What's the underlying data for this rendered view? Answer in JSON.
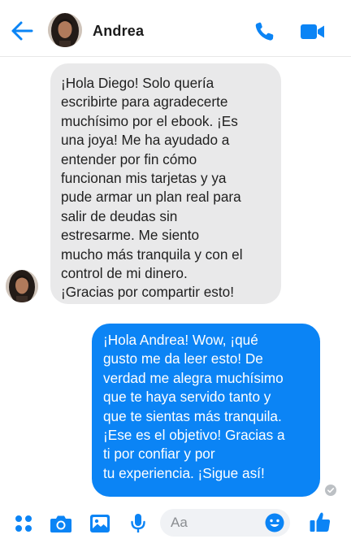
{
  "header": {
    "contact_name": "Andrea",
    "icons": [
      "back-arrow-icon",
      "phone-icon",
      "video-camera-icon"
    ]
  },
  "conversation": {
    "incoming": {
      "text": "¡Hola Diego! Solo quería\nescribirte para agradecerte\nmuchísimo por el ebook. ¡Es\nuna joya! Me ha ayudado a\nentender por fin cómo\nfuncionan mis tarjetas y ya\npude armar un plan real para\nsalir de deudas sin\nestresarme. Me siento\nmucho más tranquila y con el\ncontrol de mi dinero.\n¡Gracias por compartir esto!"
    },
    "outgoing": {
      "text": "¡Hola Andrea! Wow, ¡qué\ngusto me da leer esto! De\nverdad me alegra muchísimo\nque te haya servido tanto y\nque te sientas más tranquila.\n¡Ese es el objetivo! Gracias a\nti por confiar y por\ntu experiencia. ¡Sigue así!"
    }
  },
  "composer": {
    "placeholder": "Aa",
    "icons": [
      "apps-grid-icon",
      "camera-icon",
      "gallery-icon",
      "microphone-icon",
      "emoji-icon",
      "thumbs-up-icon"
    ]
  },
  "colors": {
    "accent": "#0b84f5",
    "incoming_bubble": "#e9e9ea",
    "outgoing_bubble": "#0b84f5"
  }
}
